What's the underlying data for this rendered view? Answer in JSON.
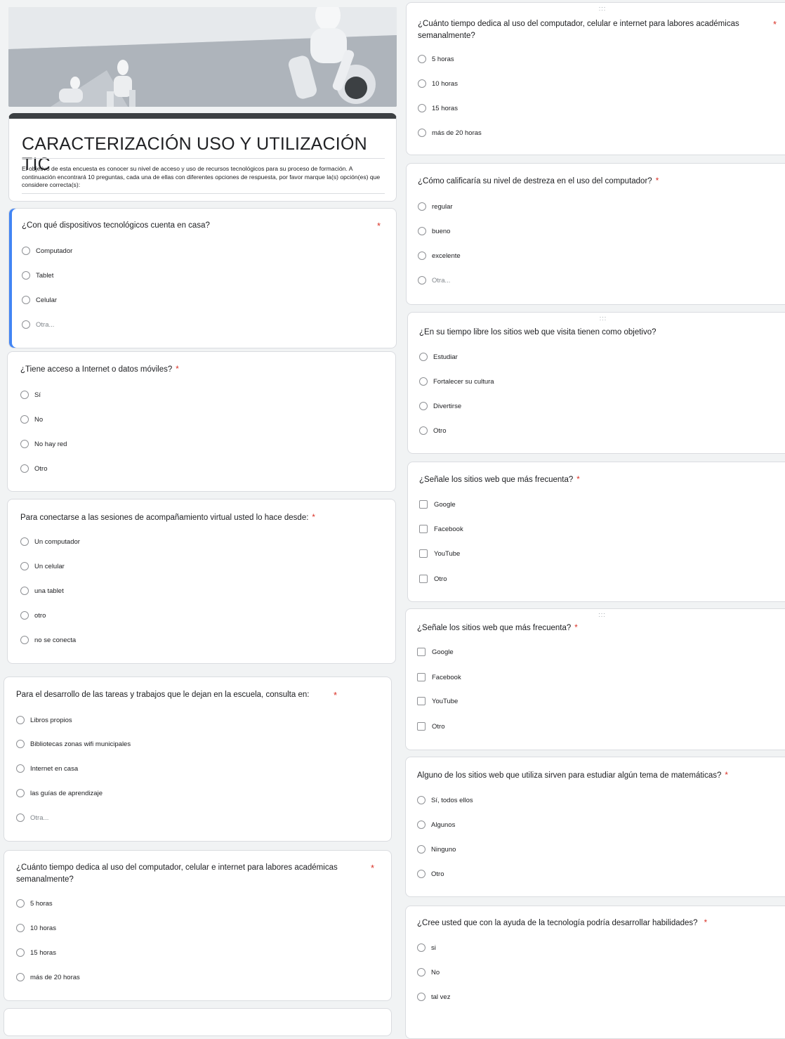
{
  "form": {
    "title": "CARACTERIZACIÓN USO Y UTILIZACIÓN TIC",
    "description": "El objetivo de esta encuesta es conocer  su nivel de acceso y uso de recursos tecnológicos para su proceso de formación. A continuación encontrará 10 preguntas, cada una de ellas con diferentes  opciones de respuesta, por favor marque la(s) opción(es) que considere correcta(s):",
    "required_mark": "*",
    "drag_handle": ":::"
  },
  "left": {
    "q1": {
      "text": "¿Con qué dispositivos tecnológicos cuenta en casa?",
      "options": [
        "Computador",
        "Tablet",
        "Celular",
        "Otra..."
      ]
    },
    "q2": {
      "text": "¿Tiene acceso a Internet o datos móviles?",
      "options": [
        "Sí",
        "No",
        "No hay red",
        "Otro"
      ]
    },
    "q3": {
      "text": "Para conectarse a las sesiones de acompañamiento virtual usted lo hace desde:",
      "options": [
        "Un computador",
        "Un celular",
        "una tablet",
        "otro",
        "no se conecta"
      ]
    },
    "q4": {
      "text": "Para el desarrollo de las tareas y trabajos que le dejan en la escuela, consulta en:",
      "options": [
        "Libros propios",
        "Bibliotecas  zonas wifi municipales",
        "Internet en casa",
        "las guías de aprendizaje",
        "Otra..."
      ]
    },
    "q5": {
      "line1": "¿Cuánto tiempo dedica al uso del computador, celular e internet para labores académicas",
      "line2": "semanalmente?",
      "options": [
        "5 horas",
        "10 horas",
        "15 horas",
        "más de 20 horas"
      ]
    }
  },
  "right": {
    "q5": {
      "line1": "¿Cuánto tiempo dedica al uso del computador, celular e internet para labores académicas",
      "line2": "semanalmente?",
      "options": [
        "5 horas",
        "10 horas",
        "15 horas",
        "más de 20 horas"
      ]
    },
    "q6": {
      "text": "¿Cómo calificaría su nivel de destreza en el uso del computador?",
      "options": [
        "regular",
        "bueno",
        "excelente",
        "Otra..."
      ]
    },
    "q7": {
      "text": "¿En su tiempo libre los sitios web que visita tienen como objetivo?",
      "options": [
        "Estudiar",
        "Fortalecer su cultura",
        "Divertirse",
        "Otro"
      ]
    },
    "q8a": {
      "text": "¿Señale  los sitios web que más frecuenta?",
      "options": [
        "Google",
        "Facebook",
        "YouTube",
        "Otro"
      ]
    },
    "q8b": {
      "text": "¿Señale  los sitios web que más frecuenta?",
      "options": [
        "Google",
        "Facebook",
        "YouTube",
        "Otro"
      ]
    },
    "q9": {
      "text": "Alguno de los sitios web que utiliza sirven para estudiar algún tema de matemáticas?",
      "options": [
        "Sí, todos ellos",
        "Algunos",
        "Ninguno",
        "Otro"
      ]
    },
    "q10": {
      "text": "¿Cree usted que con la ayuda de la tecnología podría desarrollar habilidades?",
      "options": [
        "si",
        "No",
        "tal vez"
      ]
    }
  }
}
